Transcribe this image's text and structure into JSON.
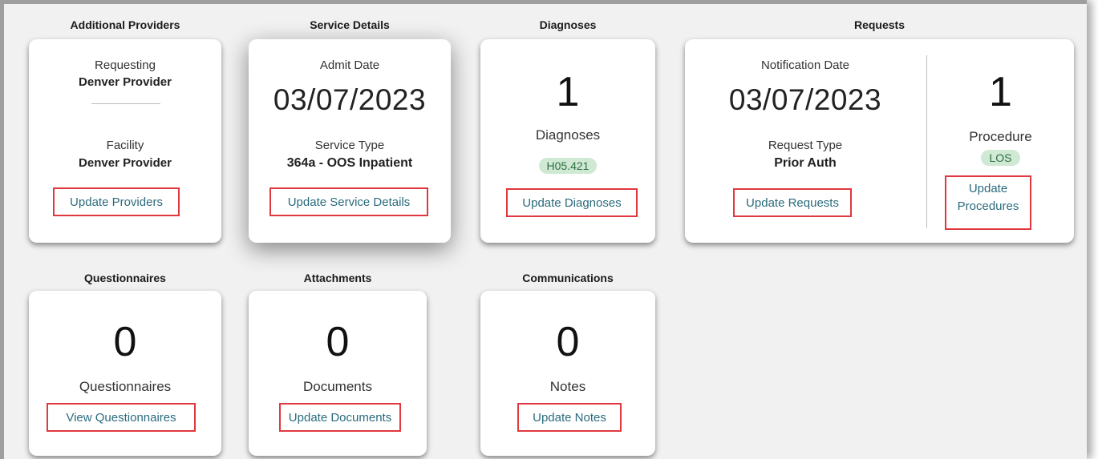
{
  "sections": {
    "additional_providers": "Additional Providers",
    "service_details": "Service Details",
    "diagnoses": "Diagnoses",
    "requests": "Requests",
    "questionnaires": "Questionnaires",
    "attachments": "Attachments",
    "communications": "Communications"
  },
  "providers": {
    "requesting_label": "Requesting",
    "requesting_value": "Denver Provider",
    "facility_label": "Facility",
    "facility_value": "Denver Provider",
    "link": "Update Providers"
  },
  "service": {
    "admit_label": "Admit Date",
    "admit_date": "03/07/2023",
    "type_label": "Service Type",
    "type_value": "364a - OOS Inpatient",
    "link": "Update Service Details"
  },
  "diagnoses": {
    "count": "1",
    "label": "Diagnoses",
    "badge": "H05.421",
    "link": "Update Diagnoses"
  },
  "requests": {
    "notification_label": "Notification Date",
    "notification_date": "03/07/2023",
    "type_label": "Request Type",
    "type_value": "Prior Auth",
    "link": "Update Requests",
    "procedure_count": "1",
    "procedure_label": "Procedure",
    "procedure_badge": "LOS",
    "procedure_link_line1": "Update",
    "procedure_link_line2": "Procedures"
  },
  "questionnaires": {
    "count": "0",
    "label": "Questionnaires",
    "link": "View Questionnaires"
  },
  "attachments": {
    "count": "0",
    "label": "Documents",
    "link": "Update Documents"
  },
  "communications": {
    "count": "0",
    "label": "Notes",
    "link": "Update Notes"
  },
  "colors": {
    "link": "#2a6b7d",
    "highlight_border": "#e0383e",
    "badge_bg": "#cfe9d5",
    "badge_text": "#2f6f3e"
  }
}
